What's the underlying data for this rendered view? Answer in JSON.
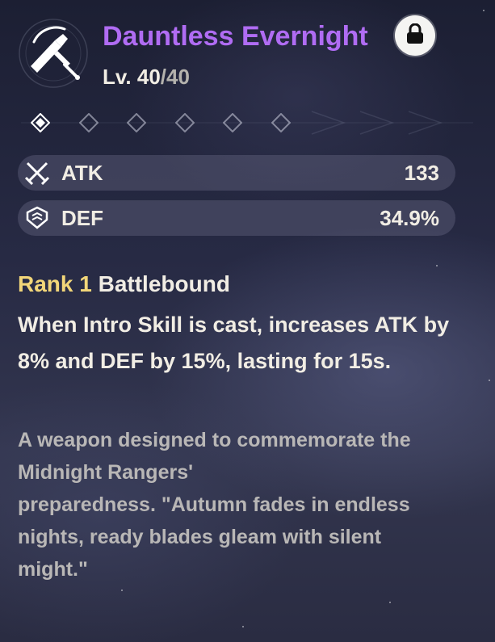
{
  "weapon": {
    "name": "Dauntless Evernight",
    "level_label": "Lv. ",
    "level_current": "40",
    "level_separator": "/",
    "level_max": "40",
    "icon": "broadsword-icon"
  },
  "lock": {
    "icon": "lock-icon",
    "locked": true
  },
  "ranks": {
    "total": 6,
    "active": 1
  },
  "stats": [
    {
      "name": "ATK",
      "value": "133",
      "icon": "crossed-swords-icon"
    },
    {
      "name": "DEF",
      "value": "34.9%",
      "icon": "shield-icon"
    }
  ],
  "passive": {
    "rank_label": "Rank 1",
    "name": "Battlebound",
    "description": "When Intro Skill is cast, increases ATK by 8% and DEF by 15%, lasting for 15s."
  },
  "lore": {
    "lines": [
      "A weapon designed to commemorate the",
      "Midnight Rangers'",
      "preparedness. \"Autumn fades in endless",
      "nights, ready blades gleam with silent",
      "might.\""
    ]
  },
  "colors": {
    "name_purple": "#b06cf3",
    "rank_gold": "#f2d679",
    "text_main": "#f1ede4",
    "text_muted": "#b9b7b6"
  }
}
